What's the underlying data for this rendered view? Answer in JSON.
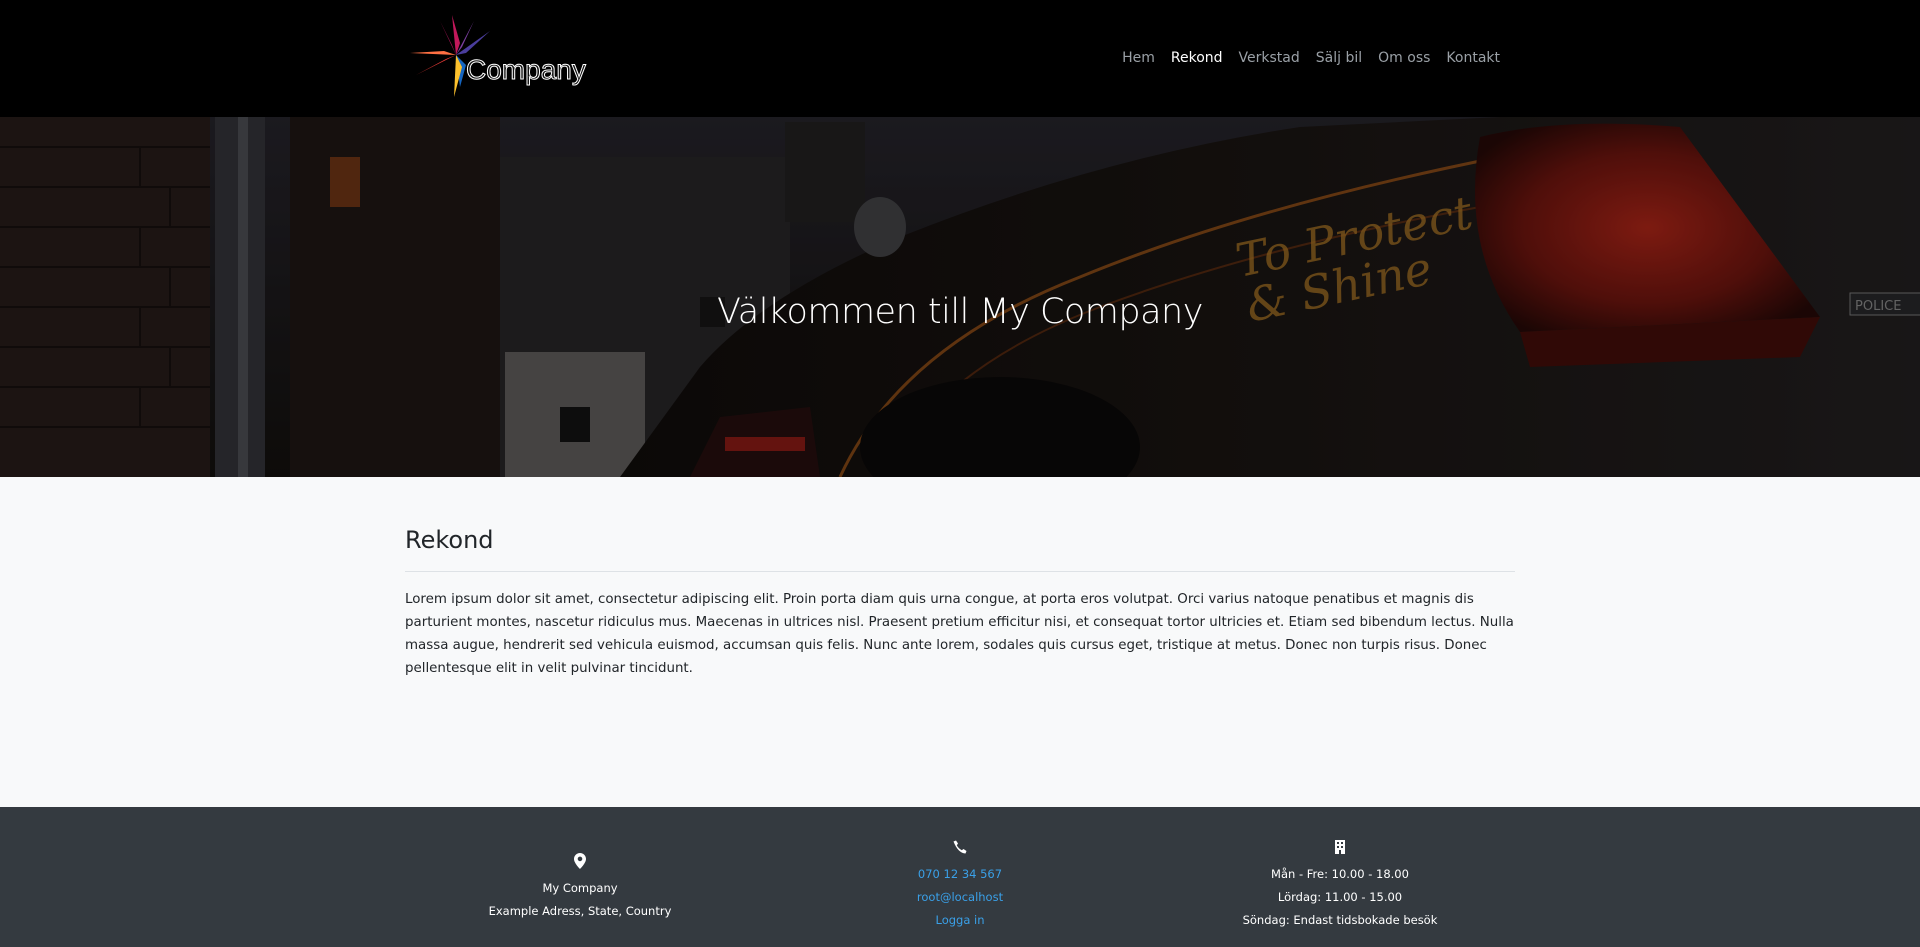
{
  "header": {
    "brand_name": "Company",
    "nav": [
      {
        "label": "Hem",
        "active": false
      },
      {
        "label": "Rekond",
        "active": true
      },
      {
        "label": "Verkstad",
        "active": false
      },
      {
        "label": "Sälj bil",
        "active": false
      },
      {
        "label": "Om oss",
        "active": false
      },
      {
        "label": "Kontakt",
        "active": false
      }
    ]
  },
  "hero": {
    "title": "Välkommen till My Company"
  },
  "content": {
    "title": "Rekond",
    "body": "Lorem ipsum dolor sit amet, consectetur adipiscing elit. Proin porta diam quis urna congue, at porta eros volutpat. Orci varius natoque penatibus et magnis dis parturient montes, nascetur ridiculus mus. Maecenas in ultrices nisl. Praesent pretium efficitur nisi, et consequat tortor ultricies et. Etiam sed bibendum lectus. Nulla massa augue, hendrerit sed vehicula euismod, accumsan quis felis. Nunc ante lorem, sodales quis cursus eget, tristique at metus. Donec non turpis risus. Donec pellentesque elit in velit pulvinar tincidunt."
  },
  "footer": {
    "address": {
      "icon": "map-pin-icon",
      "company": "My Company",
      "address": "Example Adress, State, Country"
    },
    "contact": {
      "icon": "phone-icon",
      "phone": "070 12 34 567",
      "email": "root@localhost",
      "login": "Logga in"
    },
    "hours": {
      "icon": "building-icon",
      "weekdays": "Mån - Fre: 10.00 - 18.00",
      "saturday": "Lördag: 11.00 - 15.00",
      "sunday": "Söndag: Endast tidsbokade besök"
    }
  },
  "colors": {
    "navbar_bg": "#000000",
    "main_bg": "#f8f9fa",
    "footer_bg": "#343a40",
    "link": "#3aa0e8"
  }
}
